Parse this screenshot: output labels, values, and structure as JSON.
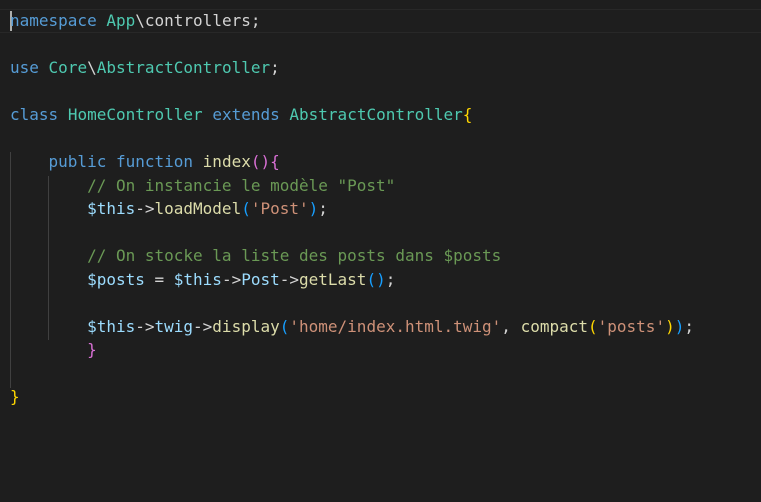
{
  "editor": {
    "lines": [
      [
        {
          "t": "namespace",
          "c": "kw"
        },
        {
          "t": " ",
          "c": "pn"
        },
        {
          "t": "App",
          "c": "ns"
        },
        {
          "t": "\\controllers;",
          "c": "pn"
        }
      ],
      [],
      [
        {
          "t": "use",
          "c": "kw"
        },
        {
          "t": " ",
          "c": "pn"
        },
        {
          "t": "Core",
          "c": "ns"
        },
        {
          "t": "\\",
          "c": "pn"
        },
        {
          "t": "AbstractController",
          "c": "ns"
        },
        {
          "t": ";",
          "c": "pn"
        }
      ],
      [],
      [
        {
          "t": "class",
          "c": "kw"
        },
        {
          "t": " ",
          "c": "pn"
        },
        {
          "t": "HomeController",
          "c": "ns"
        },
        {
          "t": " ",
          "c": "pn"
        },
        {
          "t": "extends",
          "c": "kw"
        },
        {
          "t": " ",
          "c": "pn"
        },
        {
          "t": "AbstractController",
          "c": "ns"
        },
        {
          "t": "{",
          "c": "b1"
        }
      ],
      [],
      [
        {
          "t": "    ",
          "c": "pn"
        },
        {
          "t": "public",
          "c": "kw"
        },
        {
          "t": " ",
          "c": "pn"
        },
        {
          "t": "function",
          "c": "kw"
        },
        {
          "t": " ",
          "c": "pn"
        },
        {
          "t": "index",
          "c": "fn"
        },
        {
          "t": "()",
          "c": "b2"
        },
        {
          "t": "{",
          "c": "b2"
        }
      ],
      [
        {
          "t": "        ",
          "c": "pn"
        },
        {
          "t": "// On instancie le modèle \"Post\"",
          "c": "cm"
        }
      ],
      [
        {
          "t": "        ",
          "c": "pn"
        },
        {
          "t": "$this",
          "c": "var"
        },
        {
          "t": "->",
          "c": "pn"
        },
        {
          "t": "loadModel",
          "c": "fn"
        },
        {
          "t": "(",
          "c": "b3"
        },
        {
          "t": "'Post'",
          "c": "str"
        },
        {
          "t": ")",
          "c": "b3"
        },
        {
          "t": ";",
          "c": "pn"
        }
      ],
      [],
      [
        {
          "t": "        ",
          "c": "pn"
        },
        {
          "t": "// On stocke la liste des posts dans $posts",
          "c": "cm"
        }
      ],
      [
        {
          "t": "        ",
          "c": "pn"
        },
        {
          "t": "$posts",
          "c": "var"
        },
        {
          "t": " = ",
          "c": "pn"
        },
        {
          "t": "$this",
          "c": "var"
        },
        {
          "t": "->",
          "c": "pn"
        },
        {
          "t": "Post",
          "c": "var"
        },
        {
          "t": "->",
          "c": "pn"
        },
        {
          "t": "getLast",
          "c": "fn"
        },
        {
          "t": "()",
          "c": "b3"
        },
        {
          "t": ";",
          "c": "pn"
        }
      ],
      [],
      [
        {
          "t": "        ",
          "c": "pn"
        },
        {
          "t": "$this",
          "c": "var"
        },
        {
          "t": "->",
          "c": "pn"
        },
        {
          "t": "twig",
          "c": "var"
        },
        {
          "t": "->",
          "c": "pn"
        },
        {
          "t": "display",
          "c": "fn"
        },
        {
          "t": "(",
          "c": "b3"
        },
        {
          "t": "'home/index.html.twig'",
          "c": "str"
        },
        {
          "t": ", ",
          "c": "pn"
        },
        {
          "t": "compact",
          "c": "fn"
        },
        {
          "t": "(",
          "c": "b1"
        },
        {
          "t": "'posts'",
          "c": "str"
        },
        {
          "t": ")",
          "c": "b1"
        },
        {
          "t": ")",
          "c": "b3"
        },
        {
          "t": ";",
          "c": "pn"
        }
      ],
      [
        {
          "t": "        ",
          "c": "pn"
        },
        {
          "t": "}",
          "c": "b2"
        }
      ],
      [],
      [
        {
          "t": "}",
          "c": "b1"
        }
      ]
    ]
  },
  "colors": {
    "background": "#1e1e1e",
    "keyword": "#569cd6",
    "type": "#4ec9b0",
    "function": "#dcdcaa",
    "variable": "#9cdcfe",
    "string": "#ce9178",
    "comment": "#6a9955",
    "bracket_gold": "#ffd700",
    "bracket_orchid": "#da70d6",
    "bracket_blue": "#179fff"
  }
}
